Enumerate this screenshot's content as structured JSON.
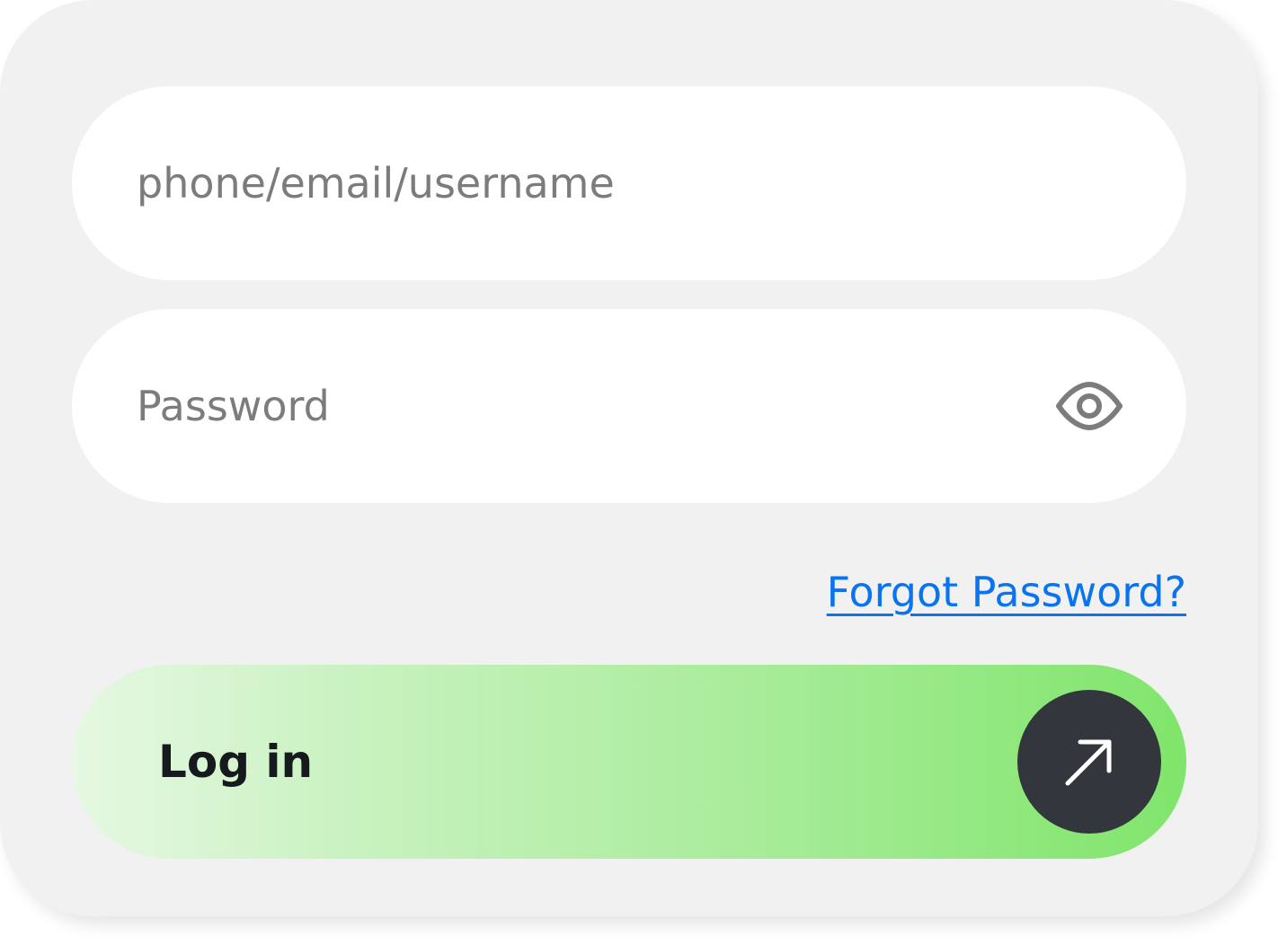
{
  "login_form": {
    "username": {
      "placeholder": "phone/email/username",
      "value": ""
    },
    "password": {
      "placeholder": "Password",
      "value": "",
      "toggle_icon": "eye-icon"
    },
    "forgot_password_label": "Forgot Password?",
    "login_button": {
      "label": "Log in",
      "icon": "arrow-up-right-icon"
    }
  },
  "colors": {
    "card_background": "#f1f1f1",
    "field_background": "#ffffff",
    "placeholder_text": "#7c7c7c",
    "link": "#0a74f0",
    "button_gradient_start": "#e6f8e3",
    "button_gradient_end": "#80e56b",
    "button_icon_background": "#33373d"
  }
}
